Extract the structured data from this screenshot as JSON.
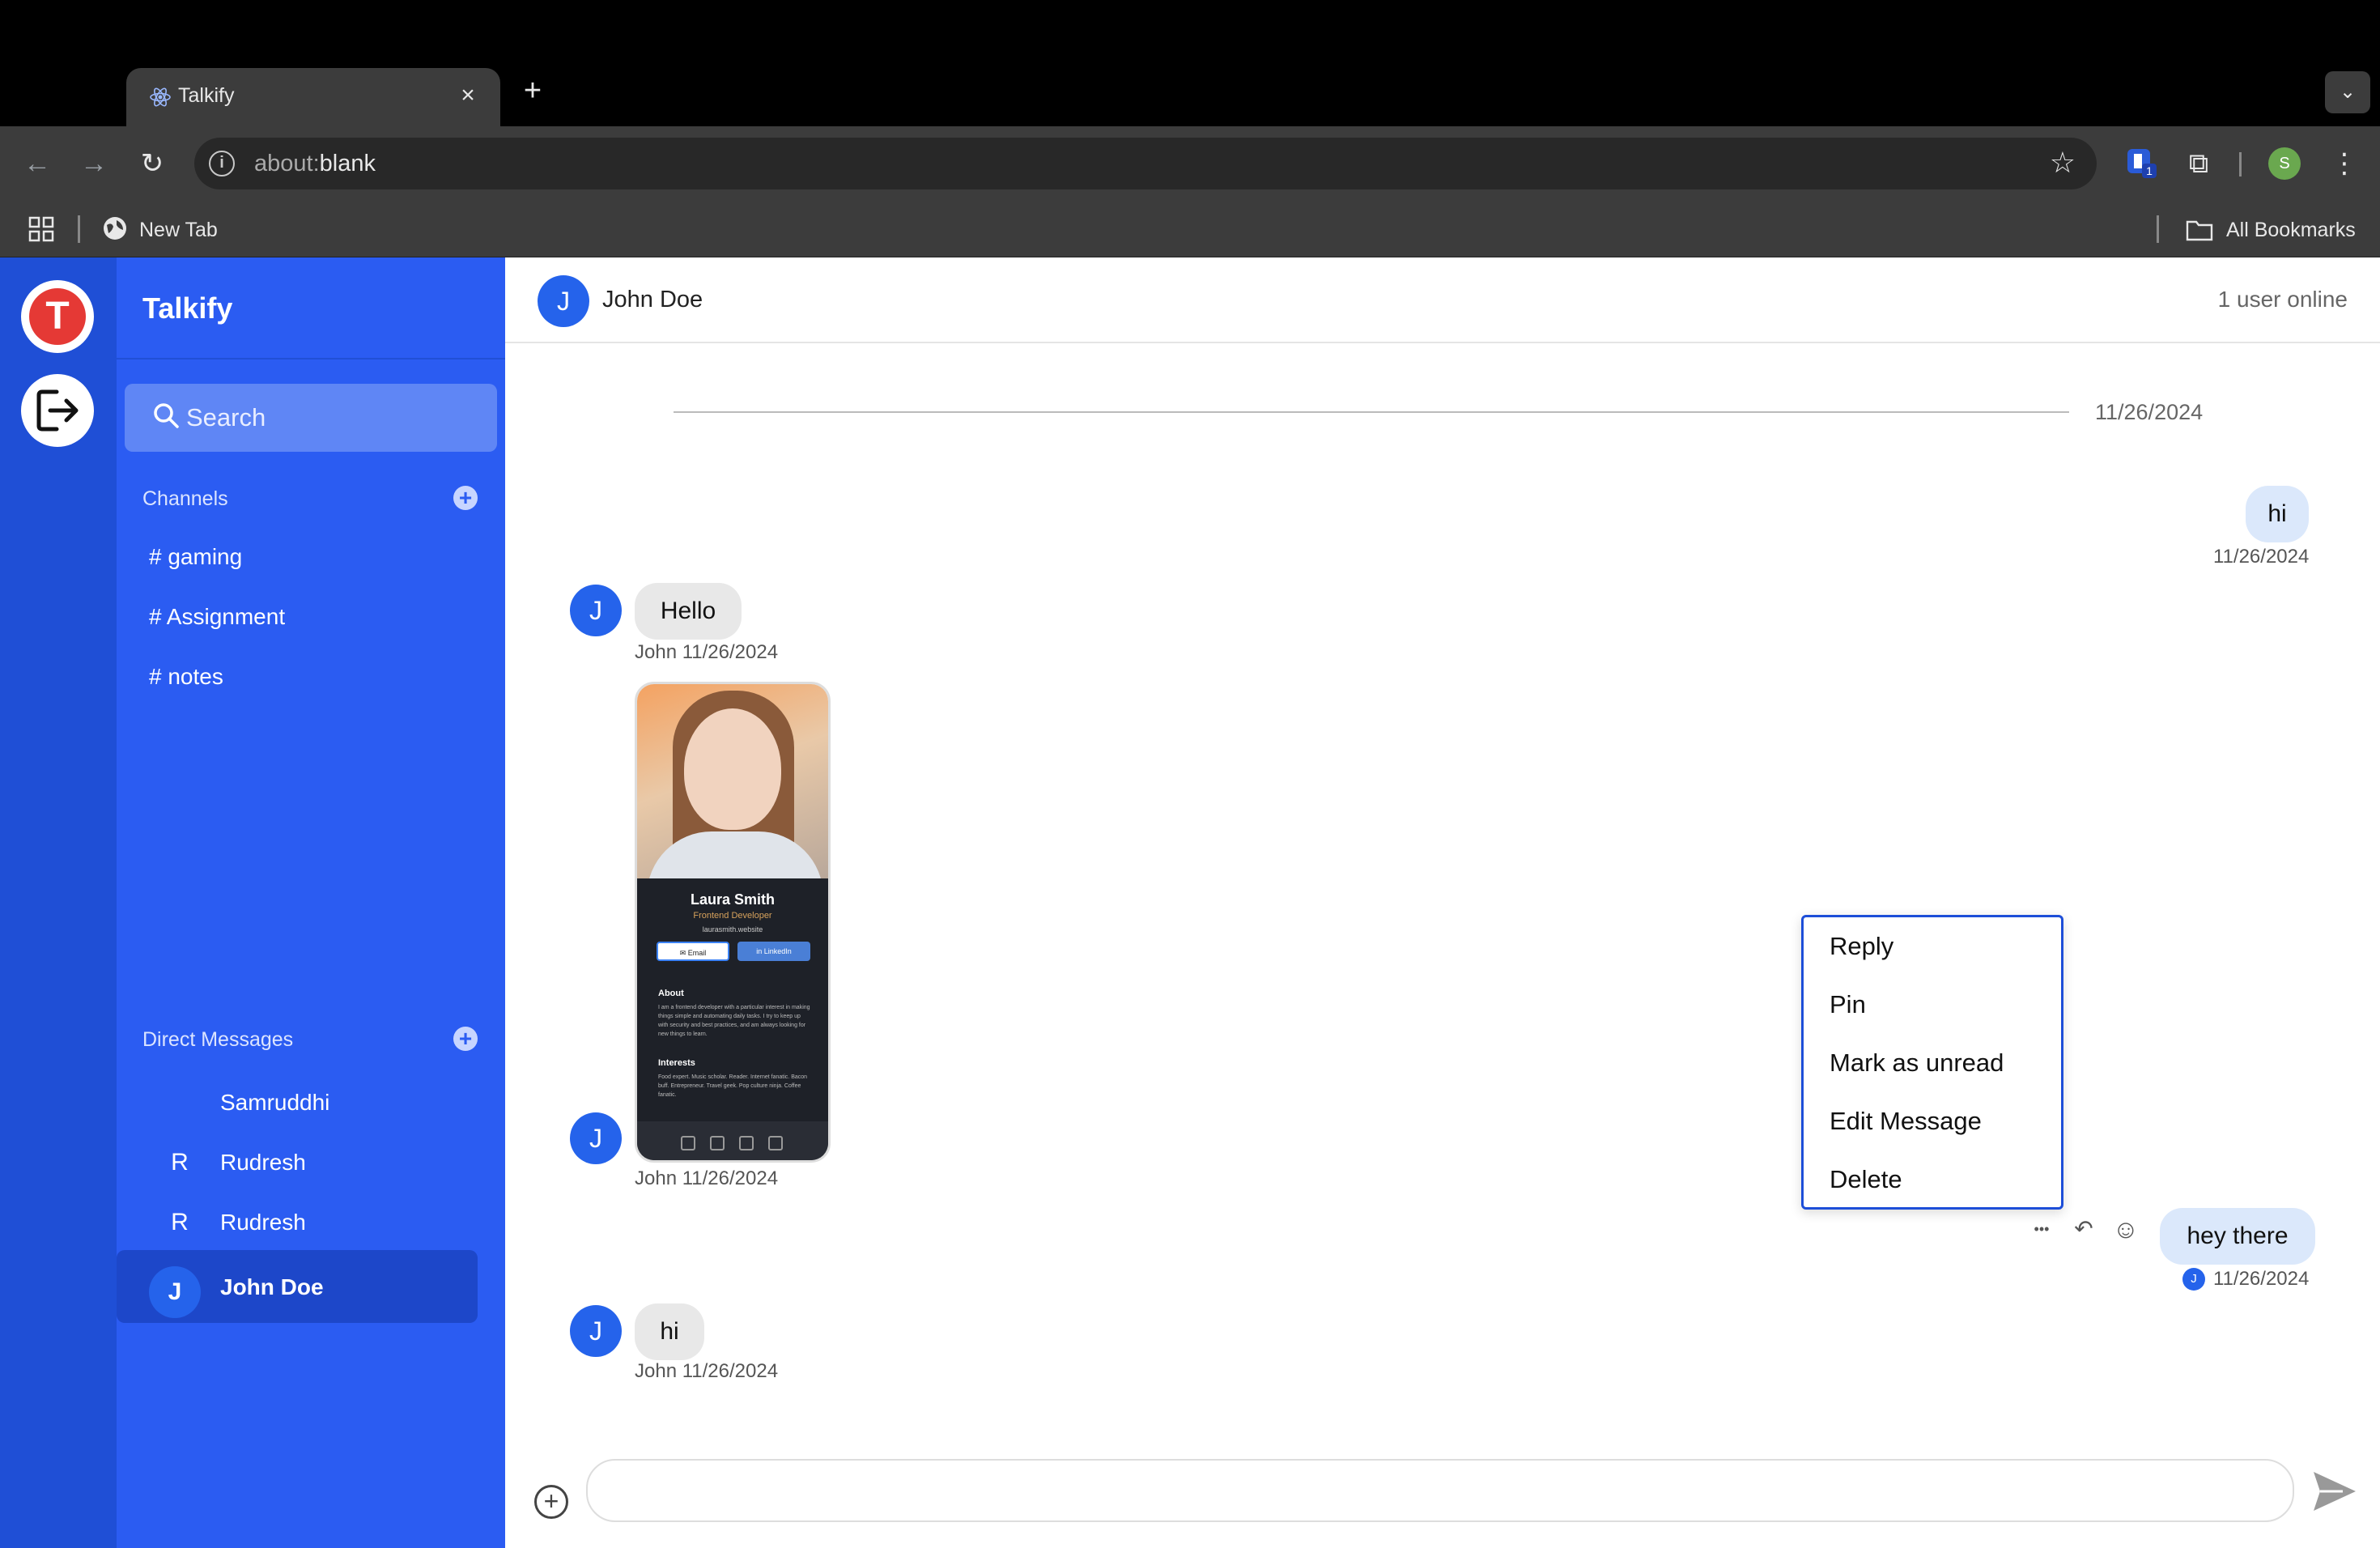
{
  "browser": {
    "tab_title": "Talkify",
    "tab_close": "×",
    "new_tab": "+",
    "tab_list": "⌄",
    "url_prefix": "about:",
    "url_rest": "blank",
    "ext_badge": "1",
    "profile_initial": "S",
    "bookmarks": {
      "new_tab": "New Tab",
      "all_bookmarks": "All Bookmarks"
    }
  },
  "rail": {
    "logo_letter": "T"
  },
  "sidebar": {
    "brand": "Talkify",
    "search_placeholder": "Search",
    "channels_title": "Channels",
    "channels": [
      "# gaming",
      "# Assignment",
      "# notes"
    ],
    "dm_title": "Direct Messages",
    "dms": [
      {
        "initial": "",
        "name": "Samruddhi"
      },
      {
        "initial": "R",
        "name": "Rudresh"
      },
      {
        "initial": "R",
        "name": "Rudresh"
      },
      {
        "initial": "J",
        "name": "John Doe",
        "active": true
      }
    ]
  },
  "chat": {
    "header": {
      "initial": "J",
      "name": "John Doe",
      "online": "1 user online"
    },
    "date_divider": "11/26/2024",
    "messages": [
      {
        "dir": "out",
        "text": "hi",
        "meta": "11/26/2024"
      },
      {
        "dir": "in",
        "initial": "J",
        "text": "Hello",
        "meta": "John 11/26/2024"
      },
      {
        "dir": "in",
        "initial": "J",
        "type": "image",
        "meta": "John 11/26/2024",
        "image": {
          "name": "Laura Smith",
          "role": "Frontend Developer",
          "site": "laurasmith.website",
          "btn_email": "✉ Email",
          "btn_linkedin": "in LinkedIn",
          "about_title": "About",
          "about_text": "I am a frontend developer with a particular interest in making things simple and automating daily tasks. I try to keep up with security and best practices, and am always looking for new things to learn.",
          "interests_title": "Interests",
          "interests_text": "Food expert. Music scholar. Reader. Internet fanatic. Bacon buff. Entrepreneur. Travel geek. Pop culture ninja. Coffee fanatic."
        }
      },
      {
        "dir": "out",
        "text": "hey there",
        "meta": "11/26/2024",
        "read_initial": "J"
      },
      {
        "dir": "in",
        "initial": "J",
        "text": "hi",
        "meta": "John 11/26/2024"
      }
    ],
    "context_menu": [
      "Reply",
      "Pin",
      "Mark as unread",
      "Edit Message",
      "Delete"
    ],
    "hover_actions": {
      "more": "•••",
      "reply": "↶",
      "emoji": "☺"
    },
    "composer": {
      "value": "",
      "attach": "+"
    }
  },
  "colors": {
    "rail": "#1f4fd6",
    "sidebar": "#2b5cf2",
    "accent": "#2563eb",
    "bubble_out": "#dbe8fb",
    "bubble_in": "#e8e8e8",
    "menu_border": "#1d4ed8"
  }
}
